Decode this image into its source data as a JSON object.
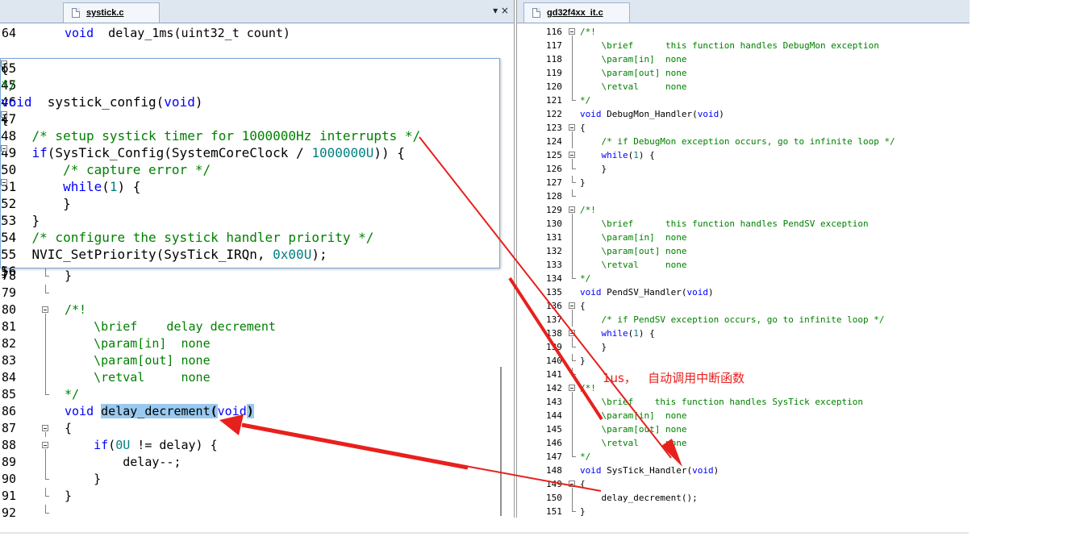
{
  "left_editor": {
    "tab": {
      "label": "systick.c",
      "icon": "file-icon"
    },
    "controls": "▾ ×",
    "code_top": [
      {
        "num": "64",
        "fold": "none",
        "parts": [
          [
            "kw",
            "void"
          ],
          [
            "",
            "  delay_1ms("
          ],
          [
            "",
            "uint32_t count)"
          ]
        ]
      }
    ],
    "popup_lines": [
      {
        "num": "65",
        "fold": "open",
        "parts": [
          [
            "",
            "{"
          ]
        ]
      },
      {
        "num": "45",
        "fold": "end",
        "parts": [
          [
            "cm",
            "*/"
          ]
        ]
      },
      {
        "num": "46",
        "fold": "none",
        "parts": [
          [
            "kw",
            "void"
          ],
          [
            "",
            "  systick_config("
          ],
          [
            "kw",
            "void"
          ],
          [
            "",
            ")"
          ]
        ]
      },
      {
        "num": "47",
        "fold": "open",
        "parts": [
          [
            "",
            "{"
          ]
        ]
      },
      {
        "num": "48",
        "fold": "line",
        "parts": [
          [
            "",
            "    "
          ],
          [
            "cm",
            "/* setup systick timer for 1000000Hz interrupts */"
          ]
        ]
      },
      {
        "num": "49",
        "fold": "open",
        "parts": [
          [
            "",
            "    "
          ],
          [
            "kw",
            "if"
          ],
          [
            "",
            "(SysTick_Config(SystemCoreClock / "
          ],
          [
            "num",
            "1000000U"
          ],
          [
            "",
            ")) {"
          ]
        ]
      },
      {
        "num": "50",
        "fold": "line",
        "parts": [
          [
            "",
            "        "
          ],
          [
            "cm",
            "/* capture error */"
          ]
        ]
      },
      {
        "num": "51",
        "fold": "open",
        "parts": [
          [
            "",
            "        "
          ],
          [
            "kw",
            "while"
          ],
          [
            "",
            "("
          ],
          [
            "num",
            "1"
          ],
          [
            "",
            ") {"
          ]
        ]
      },
      {
        "num": "52",
        "fold": "end",
        "parts": [
          [
            "",
            "        }"
          ]
        ]
      },
      {
        "num": "53",
        "fold": "end",
        "parts": [
          [
            "",
            "    }"
          ]
        ]
      },
      {
        "num": "54",
        "fold": "line",
        "parts": [
          [
            "",
            "    "
          ],
          [
            "cm",
            "/* configure the systick handler priority */"
          ]
        ]
      },
      {
        "num": "55",
        "fold": "line",
        "parts": [
          [
            "",
            "    NVIC_SetPriority(SysTick_IRQn, "
          ],
          [
            "num",
            "0x00U"
          ],
          [
            "",
            ");"
          ]
        ]
      },
      {
        "num": "56",
        "fold": "end",
        "parts": [
          [
            "",
            "}"
          ]
        ]
      }
    ],
    "code_bottom": [
      {
        "num": "78",
        "fold": "end",
        "parts": [
          [
            "",
            "}"
          ]
        ]
      },
      {
        "num": "79",
        "fold": "end",
        "parts": [
          [
            "",
            ""
          ]
        ]
      },
      {
        "num": "80",
        "fold": "open",
        "parts": [
          [
            "cm",
            "/*!"
          ]
        ]
      },
      {
        "num": "81",
        "fold": "line",
        "parts": [
          [
            "cm",
            "    \\brief    delay decrement"
          ]
        ]
      },
      {
        "num": "82",
        "fold": "line",
        "parts": [
          [
            "cm",
            "    \\param[in]  none"
          ]
        ]
      },
      {
        "num": "83",
        "fold": "line",
        "parts": [
          [
            "cm",
            "    \\param[out] none"
          ]
        ]
      },
      {
        "num": "84",
        "fold": "line",
        "parts": [
          [
            "cm",
            "    \\retval     none"
          ]
        ]
      },
      {
        "num": "85",
        "fold": "end",
        "parts": [
          [
            "cm",
            "*/"
          ]
        ]
      },
      {
        "num": "86",
        "fold": "none",
        "parts": [
          [
            "kw",
            "void"
          ],
          [
            "",
            " "
          ],
          [
            "hl",
            "delay_decrement"
          ],
          [
            "hl2",
            "("
          ],
          [
            "kw",
            "void"
          ],
          [
            "hl2",
            ")"
          ]
        ]
      },
      {
        "num": "87",
        "fold": "open",
        "parts": [
          [
            "",
            "{"
          ]
        ]
      },
      {
        "num": "88",
        "fold": "open",
        "parts": [
          [
            "",
            "    "
          ],
          [
            "kw",
            "if"
          ],
          [
            "",
            "("
          ],
          [
            "num",
            "0U"
          ],
          [
            "",
            " != delay) {"
          ]
        ]
      },
      {
        "num": "89",
        "fold": "line",
        "parts": [
          [
            "",
            "        delay--;"
          ]
        ]
      },
      {
        "num": "90",
        "fold": "end",
        "parts": [
          [
            "",
            "    }"
          ]
        ]
      },
      {
        "num": "91",
        "fold": "end",
        "parts": [
          [
            "",
            "}"
          ]
        ]
      },
      {
        "num": "92",
        "fold": "end",
        "parts": [
          [
            "",
            ""
          ]
        ]
      }
    ]
  },
  "right_editor": {
    "tab": {
      "label": "gd32f4xx_it.c",
      "icon": "file-icon"
    },
    "lines": [
      {
        "num": "116",
        "fold": "open",
        "parts": [
          [
            "cm",
            "/*!"
          ]
        ]
      },
      {
        "num": "117",
        "fold": "line",
        "parts": [
          [
            "cm",
            "    \\brief      this function handles DebugMon exception"
          ]
        ]
      },
      {
        "num": "118",
        "fold": "line",
        "parts": [
          [
            "cm",
            "    \\param[in]  none"
          ]
        ]
      },
      {
        "num": "119",
        "fold": "line",
        "parts": [
          [
            "cm",
            "    \\param[out] none"
          ]
        ]
      },
      {
        "num": "120",
        "fold": "line",
        "parts": [
          [
            "cm",
            "    \\retval     none"
          ]
        ]
      },
      {
        "num": "121",
        "fold": "end",
        "parts": [
          [
            "cm",
            "*/"
          ]
        ]
      },
      {
        "num": "122",
        "fold": "none",
        "parts": [
          [
            "kw",
            "void"
          ],
          [
            "",
            " DebugMon_Handler("
          ],
          [
            "kw",
            "void"
          ],
          [
            "",
            ")"
          ]
        ]
      },
      {
        "num": "123",
        "fold": "open",
        "parts": [
          [
            "",
            "{"
          ]
        ]
      },
      {
        "num": "124",
        "fold": "line",
        "parts": [
          [
            "",
            "    "
          ],
          [
            "cm",
            "/* if DebugMon exception occurs, go to infinite loop */"
          ]
        ]
      },
      {
        "num": "125",
        "fold": "open",
        "parts": [
          [
            "",
            "    "
          ],
          [
            "kw",
            "while"
          ],
          [
            "",
            "("
          ],
          [
            "num",
            "1"
          ],
          [
            "",
            ") {"
          ]
        ]
      },
      {
        "num": "126",
        "fold": "end",
        "parts": [
          [
            "",
            "    }"
          ]
        ]
      },
      {
        "num": "127",
        "fold": "end",
        "parts": [
          [
            "",
            "}"
          ]
        ]
      },
      {
        "num": "128",
        "fold": "end",
        "parts": [
          [
            "",
            ""
          ]
        ]
      },
      {
        "num": "129",
        "fold": "open",
        "parts": [
          [
            "cm",
            "/*!"
          ]
        ]
      },
      {
        "num": "130",
        "fold": "line",
        "parts": [
          [
            "cm",
            "    \\brief      this function handles PendSV exception"
          ]
        ]
      },
      {
        "num": "131",
        "fold": "line",
        "parts": [
          [
            "cm",
            "    \\param[in]  none"
          ]
        ]
      },
      {
        "num": "132",
        "fold": "line",
        "parts": [
          [
            "cm",
            "    \\param[out] none"
          ]
        ]
      },
      {
        "num": "133",
        "fold": "line",
        "parts": [
          [
            "cm",
            "    \\retval     none"
          ]
        ]
      },
      {
        "num": "134",
        "fold": "end",
        "parts": [
          [
            "cm",
            "*/"
          ]
        ]
      },
      {
        "num": "135",
        "fold": "none",
        "parts": [
          [
            "kw",
            "void"
          ],
          [
            "",
            " PendSV_Handler("
          ],
          [
            "kw",
            "void"
          ],
          [
            "",
            ")"
          ]
        ]
      },
      {
        "num": "136",
        "fold": "open",
        "parts": [
          [
            "",
            "{"
          ]
        ]
      },
      {
        "num": "137",
        "fold": "line",
        "parts": [
          [
            "",
            "    "
          ],
          [
            "cm",
            "/* if PendSV exception occurs, go to infinite loop */"
          ]
        ]
      },
      {
        "num": "138",
        "fold": "open",
        "parts": [
          [
            "",
            "    "
          ],
          [
            "kw",
            "while"
          ],
          [
            "",
            "("
          ],
          [
            "num",
            "1"
          ],
          [
            "",
            ") {"
          ]
        ]
      },
      {
        "num": "139",
        "fold": "end",
        "parts": [
          [
            "",
            "    }"
          ]
        ]
      },
      {
        "num": "140",
        "fold": "end",
        "parts": [
          [
            "",
            "}"
          ]
        ]
      },
      {
        "num": "141",
        "fold": "end",
        "parts": [
          [
            "",
            ""
          ]
        ]
      },
      {
        "num": "142",
        "fold": "open",
        "parts": [
          [
            "cm",
            "/*!"
          ]
        ]
      },
      {
        "num": "143",
        "fold": "line",
        "parts": [
          [
            "cm",
            "    \\brief    this function handles SysTick exception"
          ]
        ]
      },
      {
        "num": "144",
        "fold": "line",
        "parts": [
          [
            "cm",
            "    \\param[in]  none"
          ]
        ]
      },
      {
        "num": "145",
        "fold": "line",
        "parts": [
          [
            "cm",
            "    \\param[out] none"
          ]
        ]
      },
      {
        "num": "146",
        "fold": "line",
        "parts": [
          [
            "cm",
            "    \\retval     none"
          ]
        ]
      },
      {
        "num": "147",
        "fold": "end",
        "parts": [
          [
            "cm",
            "*/"
          ]
        ]
      },
      {
        "num": "148",
        "fold": "none",
        "parts": [
          [
            "kw",
            "void"
          ],
          [
            "",
            " SysTick_Handler("
          ],
          [
            "kw",
            "void"
          ],
          [
            "",
            ")"
          ]
        ]
      },
      {
        "num": "149",
        "fold": "open",
        "parts": [
          [
            "",
            "{"
          ]
        ]
      },
      {
        "num": "150",
        "fold": "line",
        "parts": [
          [
            "",
            "    delay_decrement();"
          ]
        ]
      },
      {
        "num": "151",
        "fold": "end",
        "parts": [
          [
            "",
            "}"
          ]
        ]
      }
    ]
  },
  "annotation": {
    "text": "1us，   自动调用中断函数",
    "color": "#e8201d"
  }
}
